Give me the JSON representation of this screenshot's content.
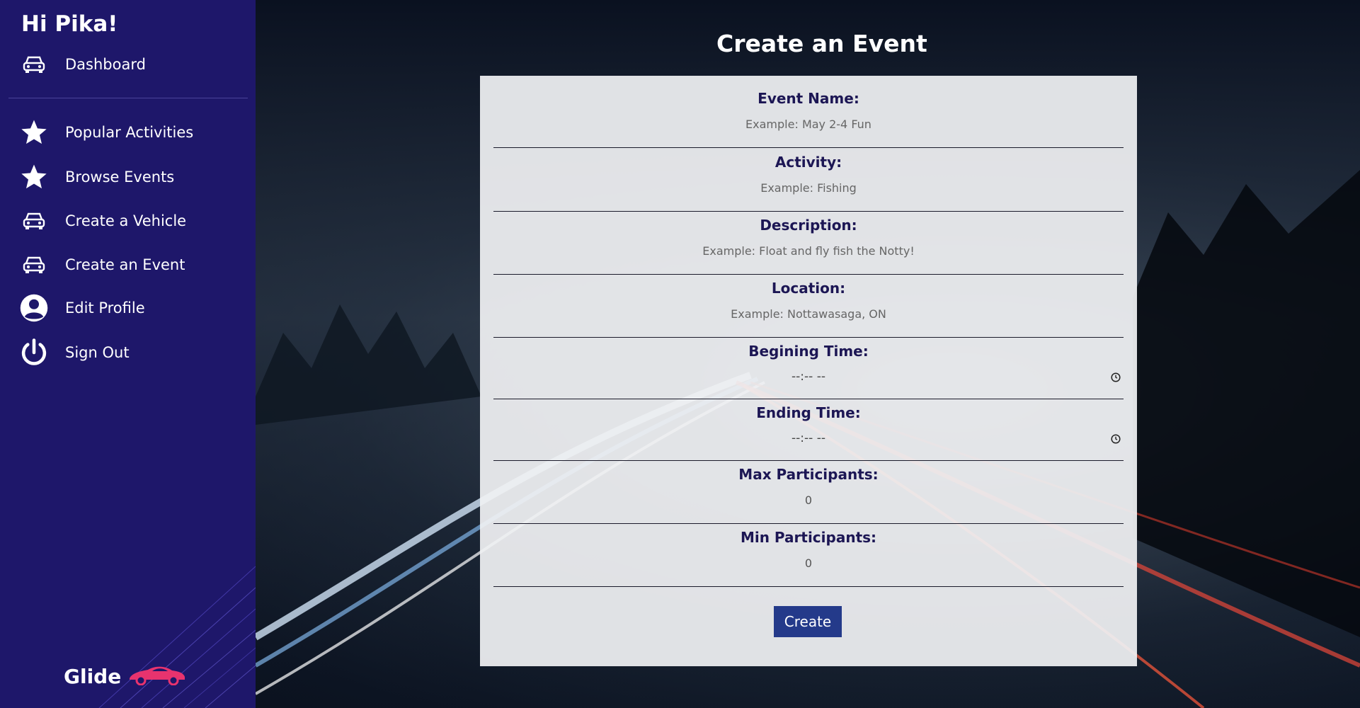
{
  "sidebar": {
    "greeting": "Hi Pika!",
    "items": [
      {
        "label": "Dashboard",
        "icon": "car-icon"
      },
      {
        "label": "Popular Activities",
        "icon": "star-icon"
      },
      {
        "label": "Browse Events",
        "icon": "star-icon"
      },
      {
        "label": "Create a Vehicle",
        "icon": "car-icon"
      },
      {
        "label": "Create an Event",
        "icon": "car-icon"
      },
      {
        "label": "Edit Profile",
        "icon": "user-circle-icon"
      },
      {
        "label": "Sign Out",
        "icon": "power-icon"
      }
    ],
    "brand": "Glide",
    "brand_icon": "sports-car-icon"
  },
  "main": {
    "title": "Create an Event",
    "form": {
      "fields": [
        {
          "label": "Event Name:",
          "placeholder": "Example: May 2-4 Fun",
          "type": "text"
        },
        {
          "label": "Activity:",
          "placeholder": "Example: Fishing",
          "type": "text"
        },
        {
          "label": "Description:",
          "placeholder": "Example: Float and fly fish the Notty!",
          "type": "text"
        },
        {
          "label": "Location:",
          "placeholder": "Example: Nottawasaga, ON",
          "type": "text"
        },
        {
          "label": "Begining Time:",
          "value": "--:-- --",
          "type": "time"
        },
        {
          "label": "Ending Time:",
          "value": "--:-- --",
          "type": "time"
        },
        {
          "label": "Max Participants:",
          "value": "0",
          "type": "number"
        },
        {
          "label": "Min Participants:",
          "value": "0",
          "type": "number"
        }
      ],
      "submit_label": "Create"
    }
  },
  "colors": {
    "sidebar_bg": "#1e176a",
    "label_text": "#1c1654",
    "button_bg": "#243a8a",
    "brand_accent": "#e8336e"
  }
}
